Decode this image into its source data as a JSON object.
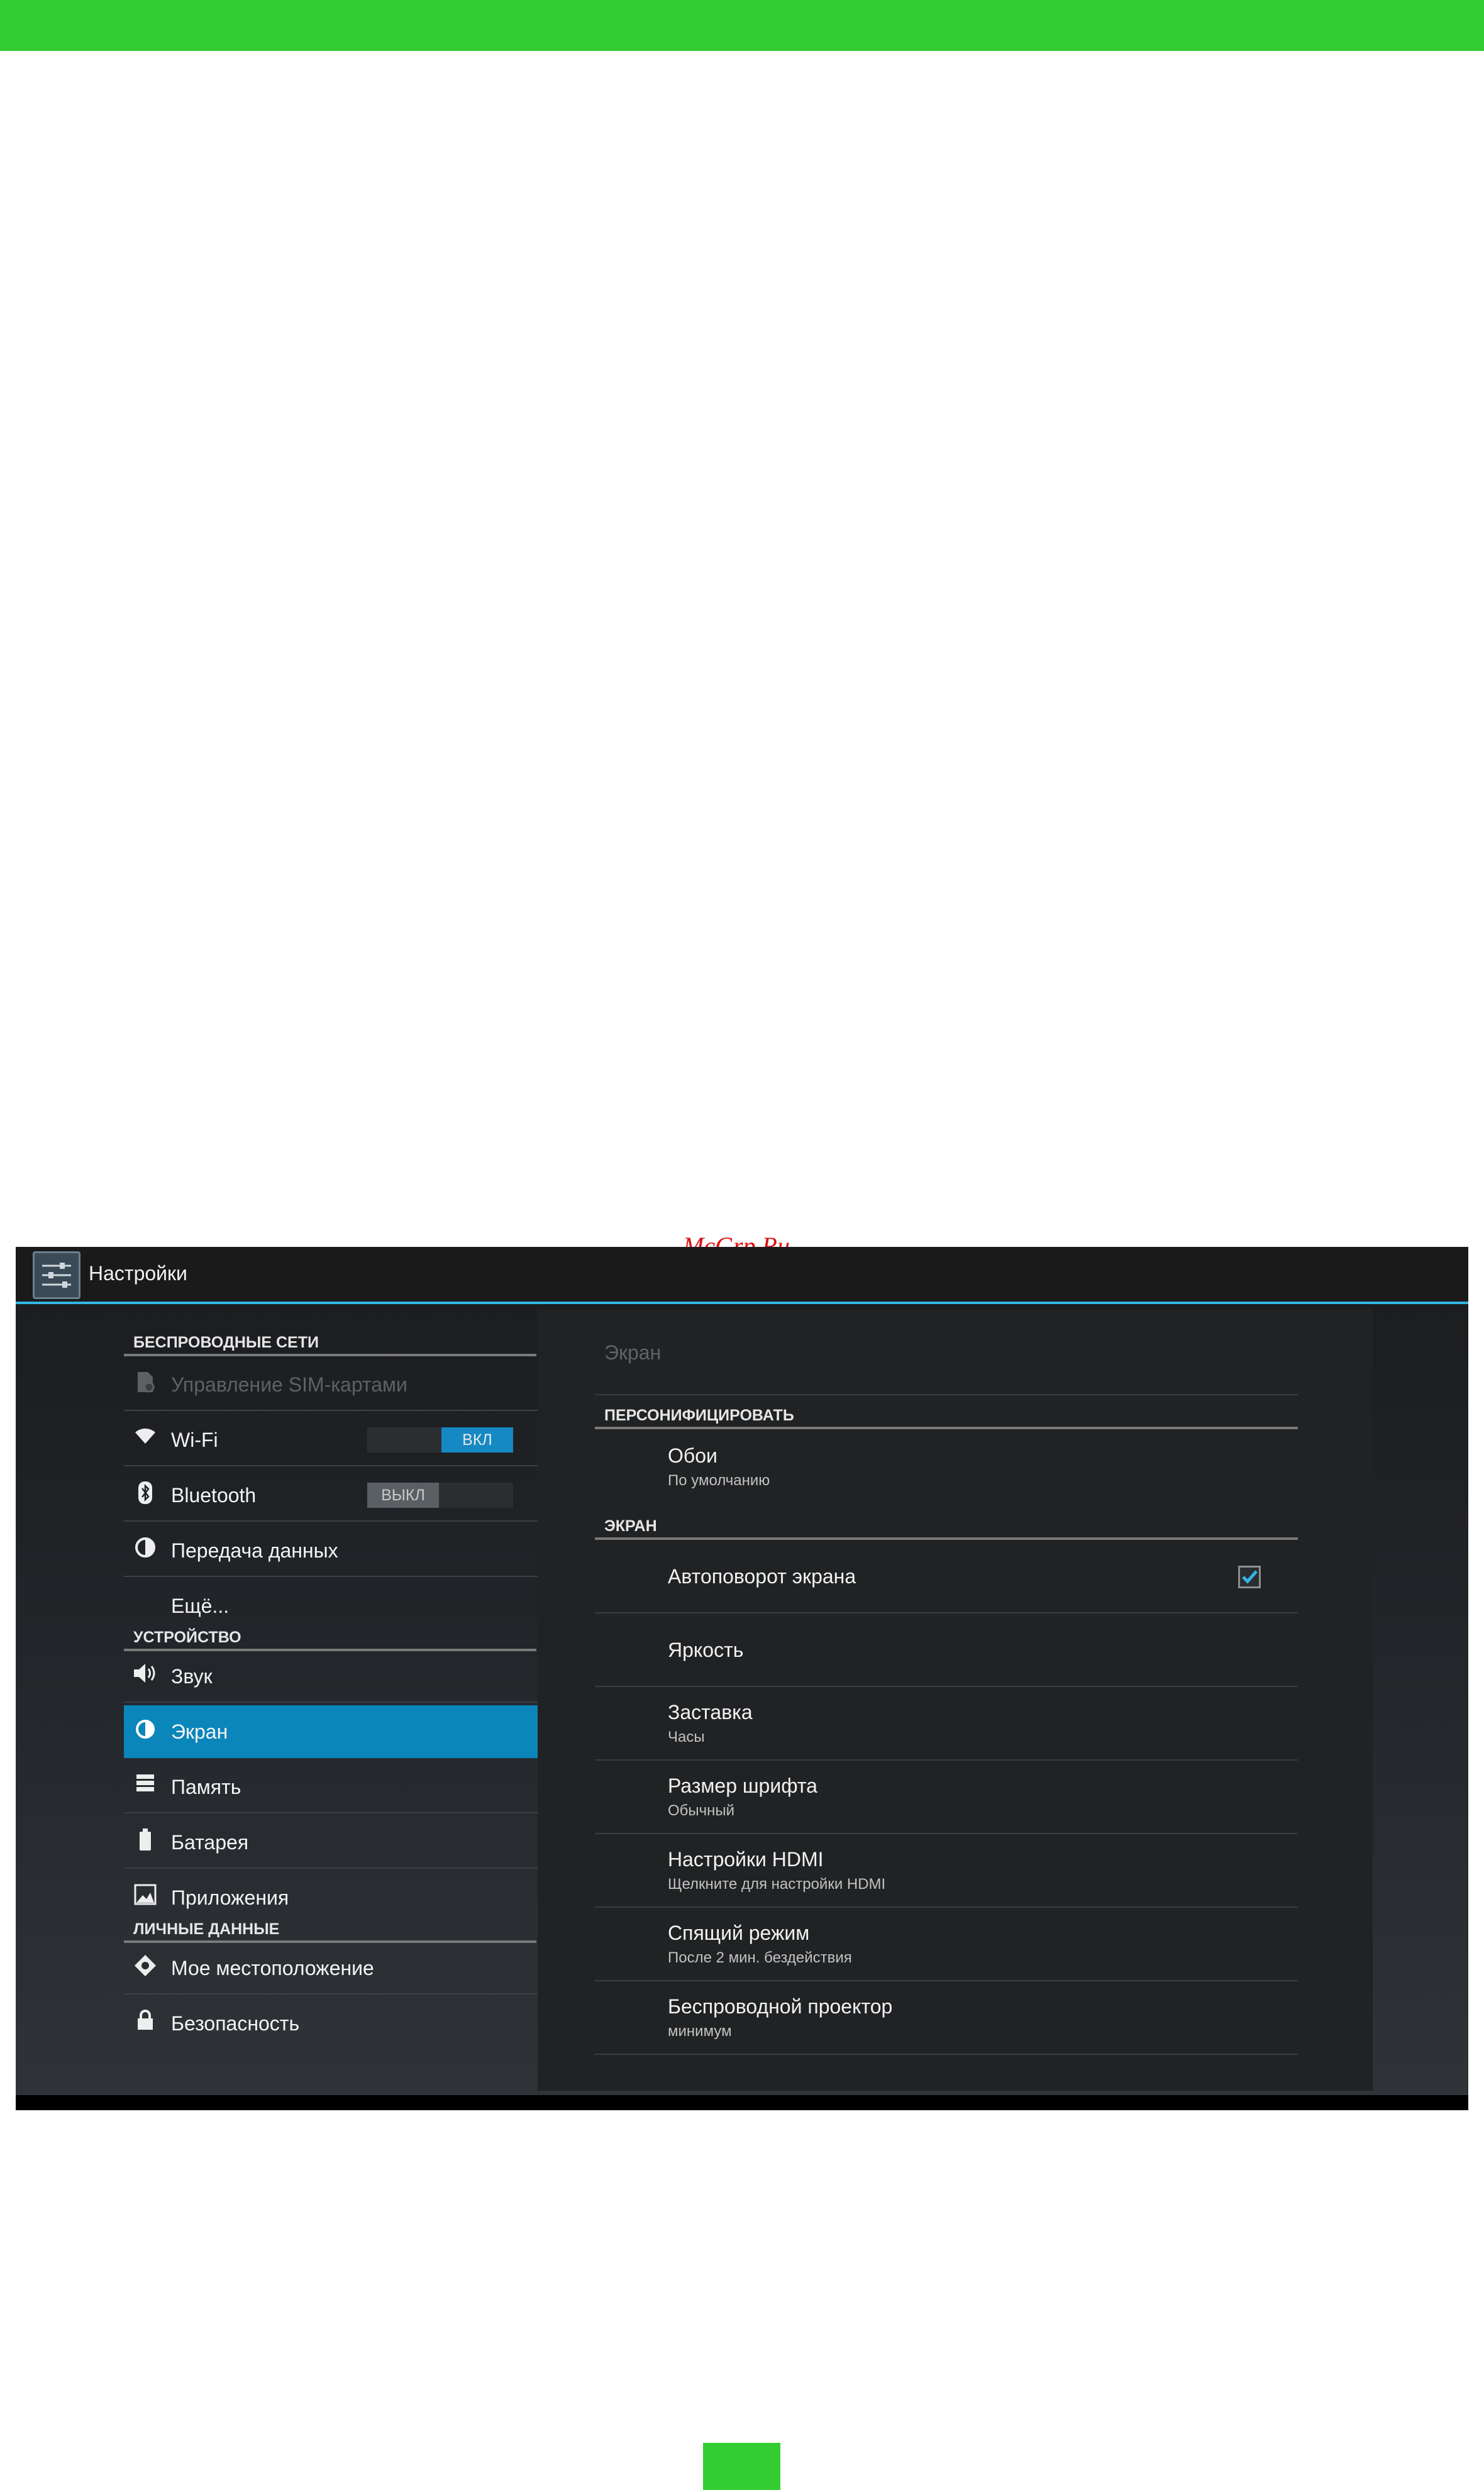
{
  "watermark": "McGrp.Ru",
  "app": {
    "title": "Настройки",
    "icon": "settings-sliders-icon"
  },
  "sidebar": {
    "sections": [
      {
        "header": "БЕСПРОВОДНЫЕ СЕТИ",
        "items": [
          {
            "label": "Управление SIM-картами",
            "icon": "sim-card-icon",
            "state": "disabled"
          },
          {
            "label": "Wi-Fi",
            "icon": "wifi-icon",
            "toggle": "ВКЛ"
          },
          {
            "label": "Bluetooth",
            "icon": "bluetooth-icon",
            "toggle": "ВЫКЛ"
          },
          {
            "label": "Передача данных",
            "icon": "data-usage-icon"
          },
          {
            "label": "Ещё..."
          }
        ]
      },
      {
        "header": "УСТРОЙСТВО",
        "items": [
          {
            "label": "Звук",
            "icon": "sound-icon"
          },
          {
            "label": "Экран",
            "icon": "display-icon",
            "state": "selected"
          },
          {
            "label": "Память",
            "icon": "storage-icon"
          },
          {
            "label": "Батарея",
            "icon": "battery-icon"
          },
          {
            "label": "Приложения",
            "icon": "apps-icon"
          }
        ]
      },
      {
        "header": "ЛИЧНЫЕ ДАННЫЕ",
        "items": [
          {
            "label": "Мое местоположение",
            "icon": "location-icon"
          },
          {
            "label": "Безопасность",
            "icon": "lock-icon"
          }
        ]
      }
    ]
  },
  "detail": {
    "title": "Экран",
    "sections": [
      {
        "header": "ПЕРСОНИФИЦИРОВАТЬ",
        "items": [
          {
            "title": "Обои",
            "summary": "По умолчанию"
          }
        ]
      },
      {
        "header": "ЭКРАН",
        "items": [
          {
            "title": "Автоповорот экрана",
            "checked": true
          },
          {
            "title": "Яркость"
          },
          {
            "title": "Заставка",
            "summary": "Часы"
          },
          {
            "title": "Размер шрифта",
            "summary": "Обычный"
          },
          {
            "title": "Настройки HDMI",
            "summary": "Щелкните для настройки HDMI"
          },
          {
            "title": "Спящий режим",
            "summary": "После 2 мин. бездействия"
          },
          {
            "title": "Беспроводной проектор",
            "summary": "минимум"
          }
        ]
      }
    ]
  },
  "colors": {
    "brand_green": "#33cc33",
    "accent": "#33b5e5",
    "selected": "#0b86ba"
  }
}
